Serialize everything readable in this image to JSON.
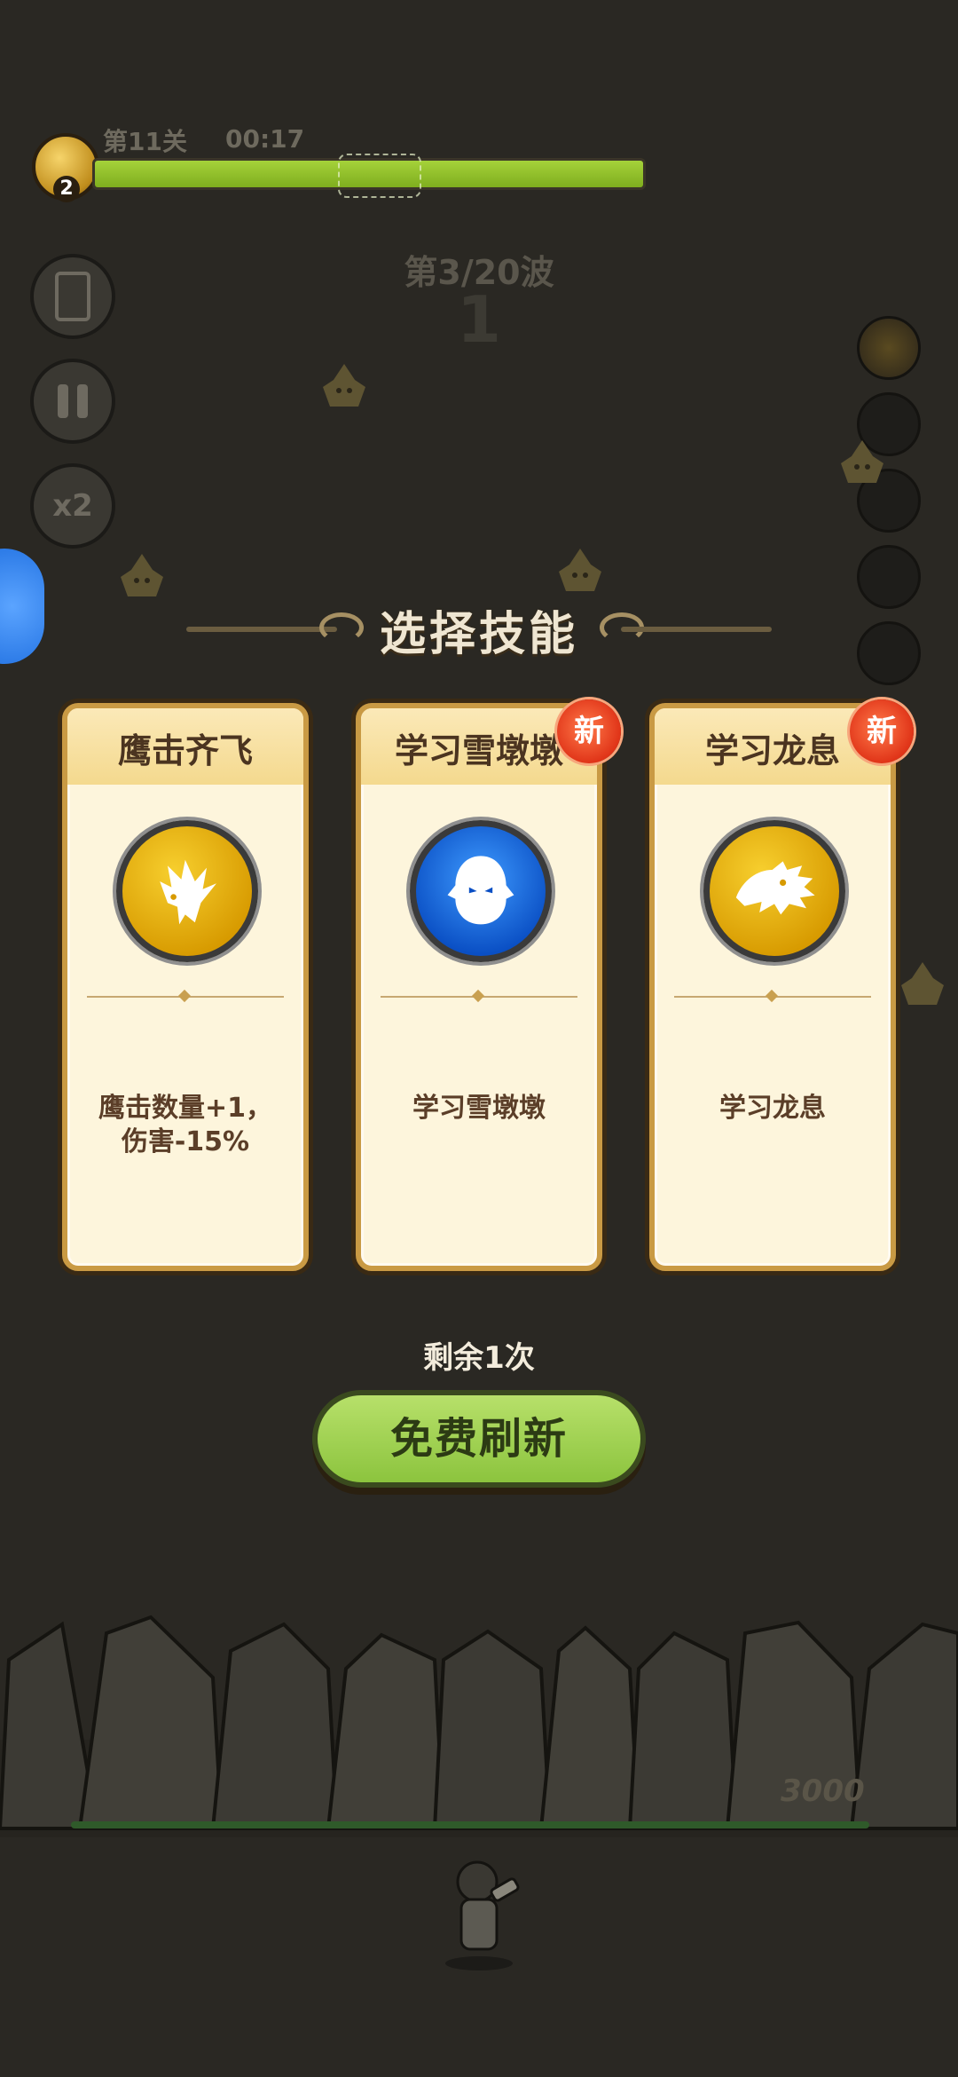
{
  "hud": {
    "level_number": "2",
    "stage_label": "第11关",
    "timer": "00:17",
    "stage_progress": 1.0,
    "wave_label": "第3/20波",
    "wave_countdown": "1"
  },
  "left_buttons": {
    "speed_label": "x2"
  },
  "skill_select": {
    "title": "选择技能",
    "cards": [
      {
        "name": "鹰击齐飞",
        "icon": "eagle-icon",
        "description": "鹰击数量+1，\n伤害-15%",
        "is_new": false
      },
      {
        "name": "学习雪墩墩",
        "icon": "snow-spirit-icon",
        "description": "学习雪墩墩",
        "is_new": true
      },
      {
        "name": "学习龙息",
        "icon": "dragon-icon",
        "description": "学习龙息",
        "is_new": true
      }
    ],
    "new_badge_label": "新",
    "remaining_label": "剩余1次",
    "refresh_button_label": "免费刷新"
  },
  "wall": {
    "hp_label": "3000"
  },
  "colors": {
    "background": "#2a2823",
    "card_bg": "#fdf5dc",
    "card_border": "#c99a44",
    "progress_green": "#8fc12a",
    "button_green": "#a6d356",
    "new_badge_red": "#e03418"
  }
}
